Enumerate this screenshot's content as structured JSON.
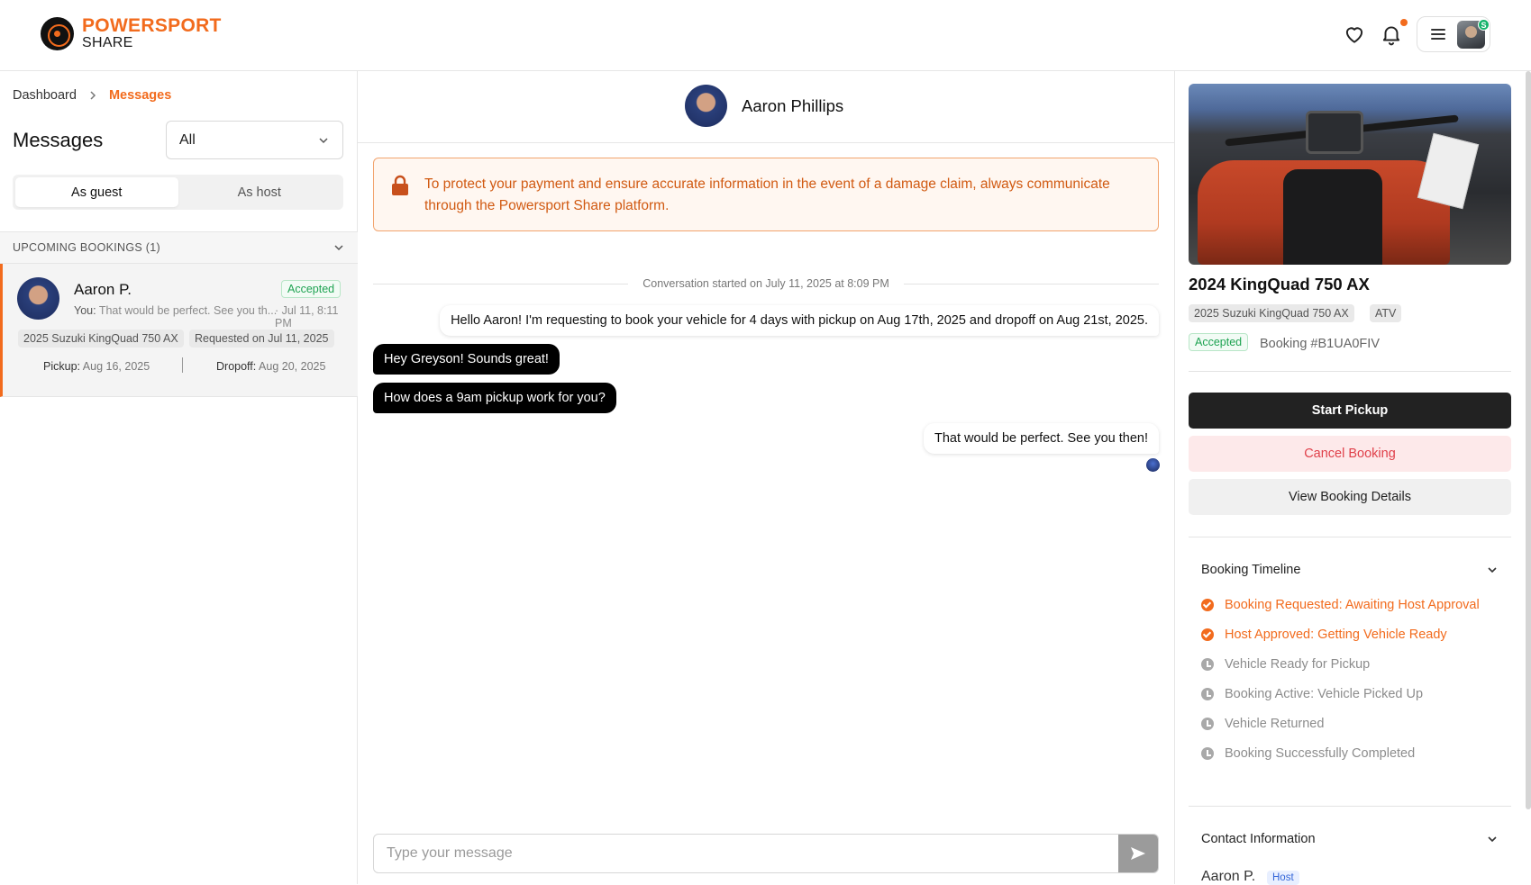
{
  "header": {
    "logo_line1": "POWERSPORT",
    "logo_line2": "SHARE",
    "profile_badge": "S"
  },
  "sidebar": {
    "breadcrumb": {
      "home": "Dashboard",
      "current": "Messages"
    },
    "title": "Messages",
    "filter": {
      "selected": "All"
    },
    "tabs": [
      {
        "label": "As guest",
        "active": true
      },
      {
        "label": "As host",
        "active": false
      }
    ],
    "section_label": "UPCOMING BOOKINGS (1)",
    "conversation": {
      "name": "Aaron P.",
      "status": "Accepted",
      "preview_sender": "You:",
      "preview_text": "That would be perfect. See you th...",
      "time": "· Jul 11, 8:11 PM",
      "vehicle": "2025 Suzuki KingQuad 750 AX",
      "requested": "Requested on Jul 11, 2025",
      "pickup_label": "Pickup:",
      "pickup_date": "Aug 16, 2025",
      "dropoff_label": "Dropoff:",
      "dropoff_date": "Aug 20, 2025"
    }
  },
  "chat": {
    "contact_name": "Aaron Phillips",
    "notice": "To protect your payment and ensure accurate information in the event of a damage claim, always communicate through the Powersport Share platform.",
    "conversation_started": "Conversation started on July 11, 2025 at 8:09 PM",
    "messages": [
      {
        "direction": "out",
        "text": "Hello Aaron! I'm requesting to book your vehicle for 4 days with pickup on Aug 17th, 2025 and dropoff on Aug 21st, 2025."
      },
      {
        "direction": "in",
        "text": "Hey Greyson! Sounds great!"
      },
      {
        "direction": "in",
        "text": "How does a 9am pickup work for you?"
      },
      {
        "direction": "out",
        "text": "That would be perfect. See you then!"
      }
    ],
    "composer_placeholder": "Type your message"
  },
  "booking": {
    "vehicle_title": "2024 KingQuad 750 AX",
    "vehicle_model": "2025 Suzuki KingQuad 750 AX",
    "vehicle_type": "ATV",
    "status": "Accepted",
    "booking_id": "Booking #B1UA0FIV",
    "buttons": {
      "start": "Start Pickup",
      "cancel": "Cancel Booking",
      "view": "View Booking Details"
    },
    "timeline_title": "Booking Timeline",
    "timeline": [
      {
        "label": "Booking Requested: Awaiting Host Approval",
        "done": true
      },
      {
        "label": "Host Approved: Getting Vehicle Ready",
        "done": true
      },
      {
        "label": "Vehicle Ready for Pickup",
        "done": false
      },
      {
        "label": "Booking Active: Vehicle Picked Up",
        "done": false
      },
      {
        "label": "Vehicle Returned",
        "done": false
      },
      {
        "label": "Booking Successfully Completed",
        "done": false
      }
    ],
    "contact_title": "Contact Information",
    "contact_name": "Aaron P.",
    "contact_role": "Host"
  },
  "colors": {
    "brand_orange": "#f26b1d",
    "accepted_green": "#1fa352",
    "cancel_red": "#e0404a"
  }
}
